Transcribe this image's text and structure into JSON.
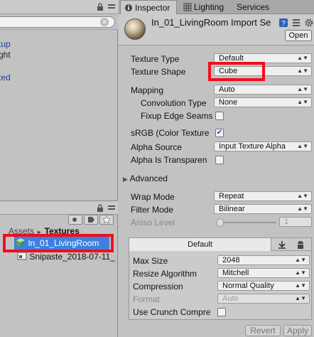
{
  "hierarchy": {
    "search_value": "",
    "rows": [
      "tup",
      "ght",
      "",
      "ted"
    ]
  },
  "project": {
    "breadcrumb_root": "Assets",
    "breadcrumb_sep": "►",
    "breadcrumb_current": "Textures",
    "assets": [
      {
        "name": "In_01_LivingRoom",
        "selected": true
      },
      {
        "name": "Snipaste_2018-07-11_"
      }
    ]
  },
  "inspector": {
    "tabs": [
      {
        "label": "Inspector",
        "active": true
      },
      {
        "label": "Lighting",
        "active": false
      },
      {
        "label": "Services",
        "active": false
      }
    ],
    "title": "In_01_LivingRoom Import Se",
    "open_label": "Open",
    "fields": {
      "texture_type": {
        "label": "Texture Type",
        "value": "Default"
      },
      "texture_shape": {
        "label": "Texture Shape",
        "value": "Cube"
      },
      "mapping": {
        "label": "Mapping",
        "value": "Auto"
      },
      "convolution_type": {
        "label": "Convolution Type",
        "value": "None"
      },
      "fixup_edge_seams": {
        "label": "Fixup Edge Seams",
        "checked": false
      },
      "srgb": {
        "label": "sRGB (Color Texture",
        "checked": true
      },
      "alpha_source": {
        "label": "Alpha Source",
        "value": "Input Texture Alpha"
      },
      "alpha_is_transparency": {
        "label": "Alpha Is Transparen",
        "checked": false
      },
      "advanced": {
        "label": "Advanced"
      },
      "wrap_mode": {
        "label": "Wrap Mode",
        "value": "Repeat"
      },
      "filter_mode": {
        "label": "Filter Mode",
        "value": "Bilinear"
      },
      "aniso_level": {
        "label": "Aniso Level",
        "value": "1"
      }
    },
    "platform": {
      "tab_label": "Default",
      "max_size": {
        "label": "Max Size",
        "value": "2048"
      },
      "resize_algorithm": {
        "label": "Resize Algorithm",
        "value": "Mitchell"
      },
      "compression": {
        "label": "Compression",
        "value": "Normal Quality"
      },
      "format": {
        "label": "Format",
        "value": "Auto"
      },
      "use_crunch": {
        "label": "Use Crunch Compre",
        "checked": false
      }
    },
    "revert_label": "Revert",
    "apply_label": "Apply"
  },
  "colors": {
    "highlight_red": "#ef0f1d",
    "selection_blue": "#3d80df"
  }
}
